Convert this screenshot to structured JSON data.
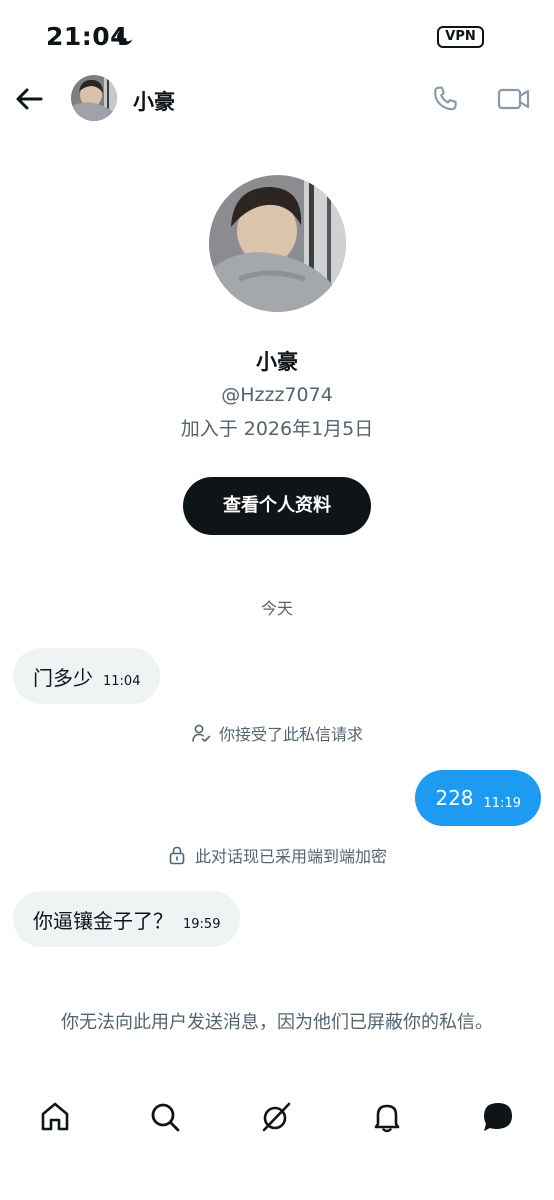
{
  "status_bar": {
    "time": "21:04",
    "vpn_label": "VPN"
  },
  "header": {
    "name": "小豪"
  },
  "profile": {
    "name": "小豪",
    "handle": "@Hzzz7074",
    "joined": "加入于 2026年1月5日",
    "view_profile_label": "查看个人资料"
  },
  "day_separator": "今天",
  "messages": [
    {
      "direction": "in",
      "text": "门多少",
      "time": "11:04"
    },
    {
      "direction": "system",
      "text": "你接受了此私信请求"
    },
    {
      "direction": "out",
      "text": "228",
      "time": "11:19"
    },
    {
      "direction": "system",
      "text": "此对话现已采用端到端加密"
    },
    {
      "direction": "in",
      "text": "你逼镶金子了？",
      "time": "19:59"
    }
  ],
  "blocked_note": "你无法向此用户发送消息，因为他们已屏蔽你的私信。",
  "bottom_nav": [
    "home-icon",
    "search-icon",
    "grok-icon",
    "notifications-icon",
    "messages-icon"
  ],
  "colors": {
    "accent": "#1d9bf0",
    "text": "#0f1419",
    "muted": "#536471",
    "bubble_in": "#eff3f4"
  }
}
